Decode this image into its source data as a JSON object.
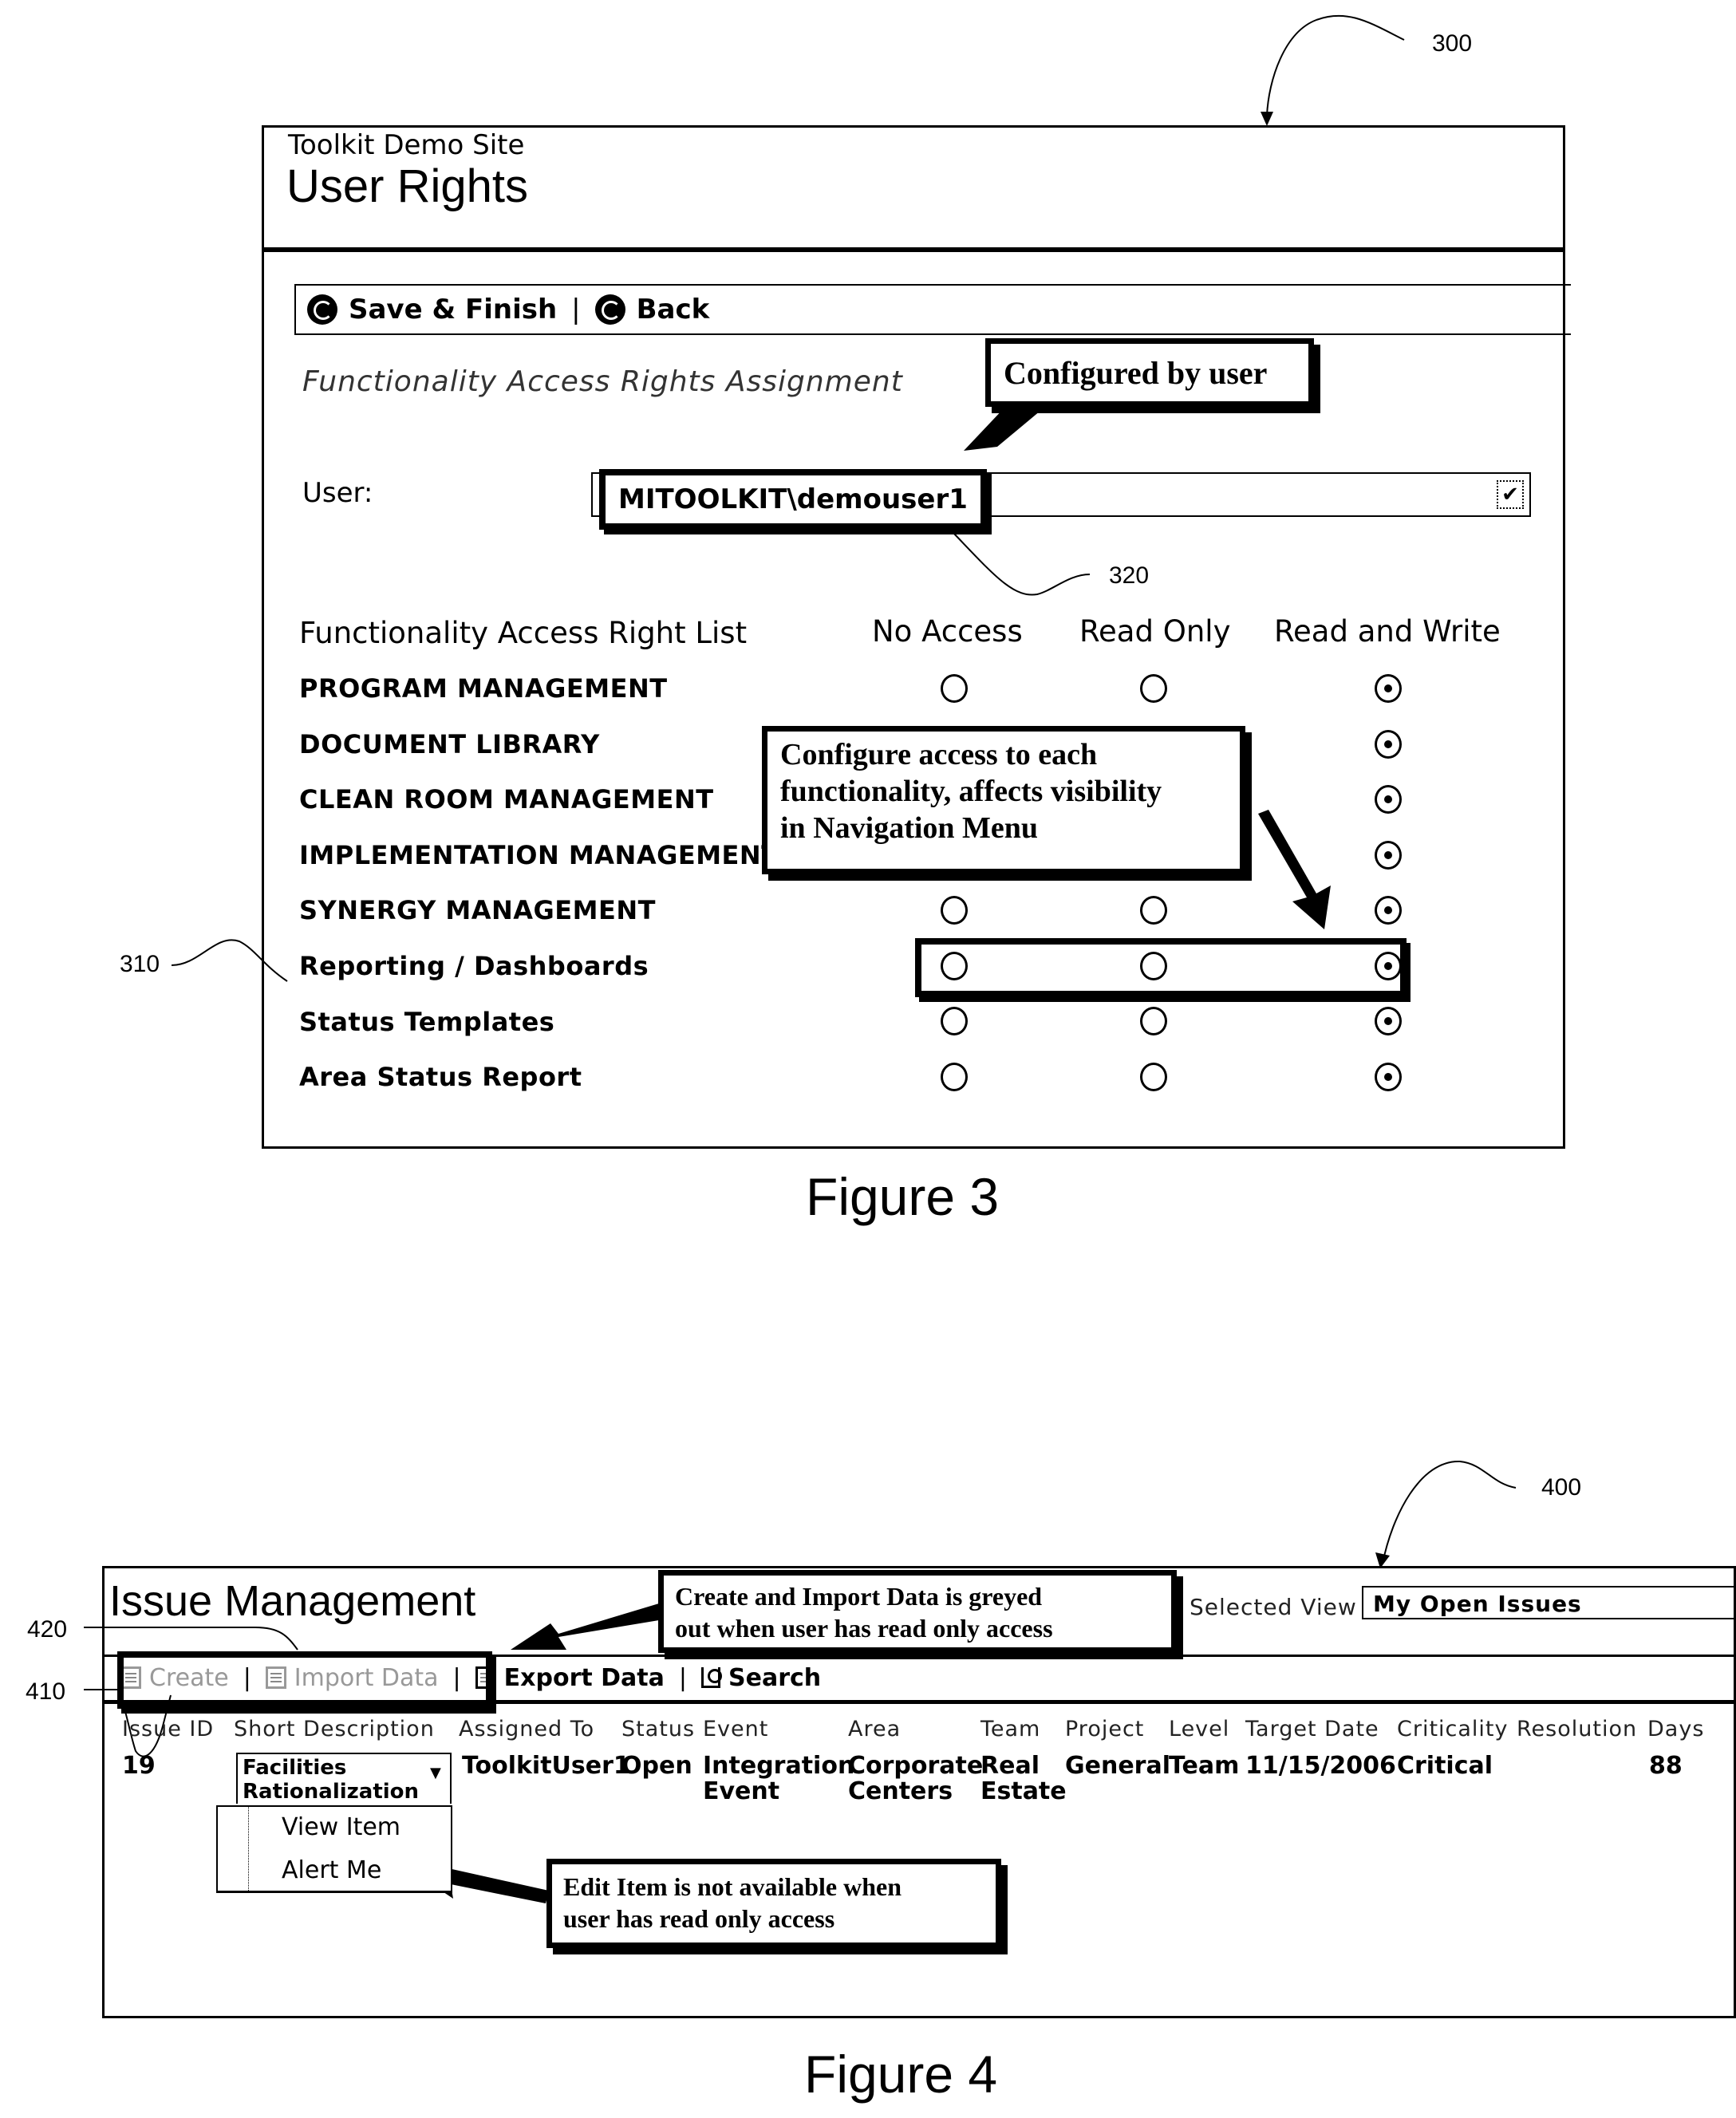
{
  "figure3": {
    "ref_number": "300",
    "site_name": "Toolkit Demo Site",
    "page_title": "User Rights",
    "toolbar": {
      "save_label": "Save & Finish",
      "separator": "|",
      "back_label": "Back"
    },
    "section_title": "Functionality Access Rights Assignment",
    "user_label": "User:",
    "user_value": "MITOOLKIT\\demouser1",
    "user_ref": "320",
    "table": {
      "header": "Functionality Access Right List",
      "columns": [
        "No Access",
        "Read Only",
        "Read and Write"
      ],
      "rows": [
        {
          "label": "PROGRAM MANAGEMENT",
          "selected": "Read and Write",
          "hidden_options": []
        },
        {
          "label": "DOCUMENT LIBRARY",
          "selected": "Read and Write",
          "hidden_options": [
            "No Access",
            "Read Only"
          ]
        },
        {
          "label": "CLEAN ROOM MANAGEMENT",
          "selected": "Read and Write",
          "hidden_options": [
            "No Access",
            "Read Only"
          ]
        },
        {
          "label": "IMPLEMENTATION MANAGEMENT",
          "selected": "Read and Write",
          "hidden_options": [
            "No Access",
            "Read Only"
          ]
        },
        {
          "label": "SYNERGY MANAGEMENT",
          "selected": "Read and Write",
          "hidden_options": []
        },
        {
          "label": "Reporting / Dashboards",
          "selected": "Read and Write",
          "hidden_options": []
        },
        {
          "label": "Status Templates",
          "selected": "Read and Write",
          "hidden_options": []
        },
        {
          "label": "Area Status Report",
          "selected": "Read and Write",
          "hidden_options": []
        }
      ]
    },
    "row_ref": "310",
    "callouts": {
      "configured": "Configured by user",
      "configure_access_lines": [
        "Configure access to each",
        "functionality, affects visibility",
        "in Navigation Menu"
      ]
    },
    "caption": "Figure 3"
  },
  "figure4": {
    "ref_number": "400",
    "title": "Issue Management",
    "selected_view_label": "Selected View",
    "selected_view_value": "My Open Issues",
    "toolbar": {
      "create_label": "Create",
      "import_label": "Import Data",
      "export_label": "Export Data",
      "search_label": "Search",
      "separator": "|"
    },
    "refs": {
      "toolbar_box": "420",
      "issue_id": "410"
    },
    "columns": [
      "Issue ID",
      "Short Description",
      "Assigned To",
      "Status",
      "Event",
      "Area",
      "Team",
      "Project",
      "Level",
      "Target Date",
      "Criticality",
      "Resolution",
      "Days"
    ],
    "row": {
      "issue_id": "19",
      "short_description_lines": [
        "Facilities",
        "Rationalization"
      ],
      "assigned_to": "ToolkitUser1",
      "status": "Open",
      "event_lines": [
        "Integration",
        "Event"
      ],
      "area_lines": [
        "Corporate",
        "Centers"
      ],
      "team_lines": [
        "Real",
        "Estate"
      ],
      "project": "General",
      "level": "Team",
      "target_date": "11/15/2006",
      "criticality": "Critical",
      "resolution": "",
      "days": "88"
    },
    "context_menu": [
      "View Item",
      "Alert Me"
    ],
    "callouts": {
      "greyed_lines": [
        "Create and Import Data is greyed",
        "out when user has read only access"
      ],
      "edit_lines": [
        "Edit Item is not available when",
        "user has read only access"
      ]
    },
    "caption": "Figure 4"
  }
}
